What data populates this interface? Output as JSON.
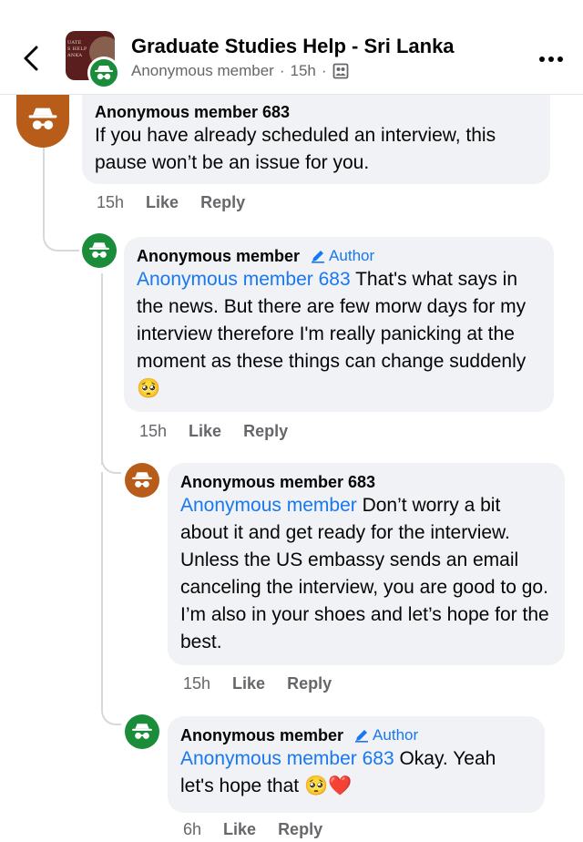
{
  "header": {
    "group_name": "Graduate Studies Help - Sri Lanka",
    "poster": "Anonymous member",
    "time": "15h",
    "separator": "·",
    "avatar_text": "UATE\nS HELP\nANKA"
  },
  "comments": [
    {
      "author": "Anonymous member 683",
      "text": "If you have already scheduled an interview, this pause won’t be an issue for you.",
      "time": "15h",
      "like": "Like",
      "reply": "Reply"
    },
    {
      "author": "Anonymous member",
      "author_tag": "Author",
      "mention": "Anonymous member 683",
      "text": " That's what says in the news. But there are few morw days for my interview therefore I'm really panicking at the moment as these things can change suddenly",
      "emoji": "🥺",
      "time": "15h",
      "like": "Like",
      "reply": "Reply"
    },
    {
      "author": "Anonymous member 683",
      "mention": "Anonymous member",
      "text": " Don’t worry a bit about it and get ready for the interview. Unless the US embassy sends an email canceling the interview, you are good to go. I’m also in your shoes and let’s hope for the best.",
      "time": "15h",
      "like": "Like",
      "reply": "Reply"
    },
    {
      "author": "Anonymous member",
      "author_tag": "Author",
      "mention": "Anonymous member 683",
      "text": " Okay. Yeah let's hope that",
      "emoji": "🥺",
      "emoji2": "❤️",
      "time": "6h",
      "like": "Like",
      "reply": "Reply"
    }
  ],
  "colors": {
    "link": "#1877f2",
    "bubble": "#f0f2f5",
    "meta": "#65676b",
    "avatar_brown": "#b85c19",
    "avatar_green": "#1a8c3a"
  }
}
